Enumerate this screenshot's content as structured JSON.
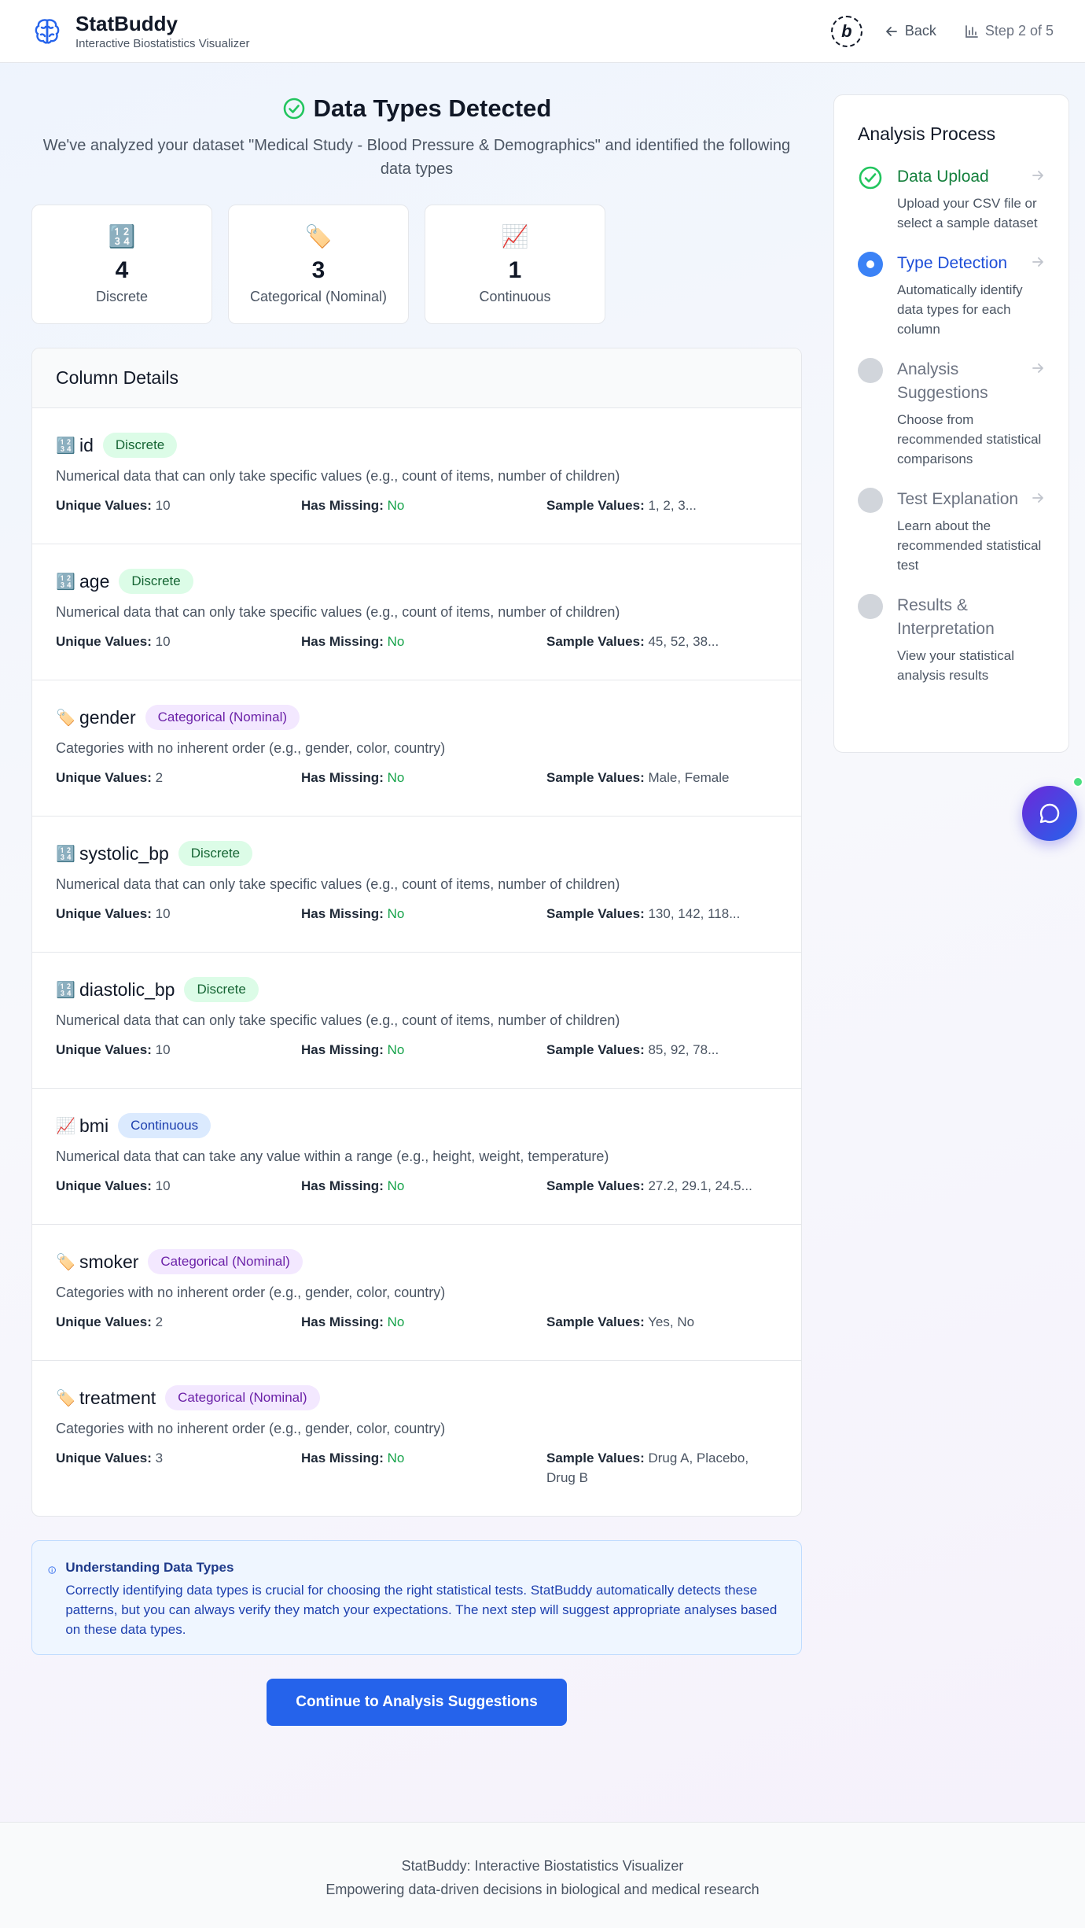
{
  "header": {
    "brand": "StatBuddy",
    "subtitle": "Interactive Biostatistics Visualizer",
    "badge_letter": "b",
    "back_label": "Back",
    "step_label": "Step 2 of 5"
  },
  "main": {
    "title": "Data Types Detected",
    "description": "We've analyzed your dataset \"Medical Study - Blood Pressure & Demographics\" and identified the following data types",
    "summary": [
      {
        "icon": "numbers-icon",
        "glyph": "🔢",
        "count": "4",
        "label": "Discrete"
      },
      {
        "icon": "tag-icon",
        "glyph": "🏷️",
        "count": "3",
        "label": "Categorical (Nominal)"
      },
      {
        "icon": "chart-icon",
        "glyph": "📈",
        "count": "1",
        "label": "Continuous"
      }
    ],
    "details_title": "Column Details",
    "labels": {
      "unique": "Unique Values:",
      "missing": "Has Missing:",
      "sample": "Sample Values:"
    },
    "columns": [
      {
        "icon": "🔢",
        "name": "id",
        "type": "Discrete",
        "desc": "Numerical data that can only take specific values (e.g., count of items, number of children)",
        "unique": "10",
        "missing": "No",
        "sample": "1, 2, 3..."
      },
      {
        "icon": "🔢",
        "name": "age",
        "type": "Discrete",
        "desc": "Numerical data that can only take specific values (e.g., count of items, number of children)",
        "unique": "10",
        "missing": "No",
        "sample": "45, 52, 38..."
      },
      {
        "icon": "🏷️",
        "name": "gender",
        "type": "Categorical (Nominal)",
        "desc": "Categories with no inherent order (e.g., gender, color, country)",
        "unique": "2",
        "missing": "No",
        "sample": "Male, Female"
      },
      {
        "icon": "🔢",
        "name": "systolic_bp",
        "type": "Discrete",
        "desc": "Numerical data that can only take specific values (e.g., count of items, number of children)",
        "unique": "10",
        "missing": "No",
        "sample": "130, 142, 118..."
      },
      {
        "icon": "🔢",
        "name": "diastolic_bp",
        "type": "Discrete",
        "desc": "Numerical data that can only take specific values (e.g., count of items, number of children)",
        "unique": "10",
        "missing": "No",
        "sample": "85, 92, 78..."
      },
      {
        "icon": "📈",
        "name": "bmi",
        "type": "Continuous",
        "desc": "Numerical data that can take any value within a range (e.g., height, weight, temperature)",
        "unique": "10",
        "missing": "No",
        "sample": "27.2, 29.1, 24.5..."
      },
      {
        "icon": "🏷️",
        "name": "smoker",
        "type": "Categorical (Nominal)",
        "desc": "Categories with no inherent order (e.g., gender, color, country)",
        "unique": "2",
        "missing": "No",
        "sample": "Yes, No"
      },
      {
        "icon": "🏷️",
        "name": "treatment",
        "type": "Categorical (Nominal)",
        "desc": "Categories with no inherent order (e.g., gender, color, country)",
        "unique": "3",
        "missing": "No",
        "sample": "Drug A, Placebo, Drug B"
      }
    ],
    "info": {
      "title": "Understanding Data Types",
      "text": "Correctly identifying data types is crucial for choosing the right statistical tests. StatBuddy automatically detects these patterns, but you can always verify they match your expectations. The next step will suggest appropriate analyses based on these data types."
    },
    "continue_label": "Continue to Analysis Suggestions"
  },
  "sidebar": {
    "title": "Analysis Process",
    "steps": [
      {
        "name": "Data Upload",
        "desc": "Upload your CSV file or select a sample dataset",
        "state": "done"
      },
      {
        "name": "Type Detection",
        "desc": "Automatically identify data types for each column",
        "state": "active"
      },
      {
        "name": "Analysis Suggestions",
        "desc": "Choose from recommended statistical comparisons",
        "state": "pending"
      },
      {
        "name": "Test Explanation",
        "desc": "Learn about the recommended statistical test",
        "state": "pending"
      },
      {
        "name": "Results & Interpretation",
        "desc": "View your statistical analysis results",
        "state": "pending"
      }
    ]
  },
  "footer": {
    "line1": "StatBuddy: Interactive Biostatistics Visualizer",
    "line2": "Empowering data-driven decisions in biological and medical research"
  },
  "colors": {
    "accent": "#2563eb",
    "success": "#16a34a",
    "discrete_bg": "#dcfce7",
    "nominal_bg": "#f3e8ff",
    "continuous_bg": "#dbeafe"
  }
}
